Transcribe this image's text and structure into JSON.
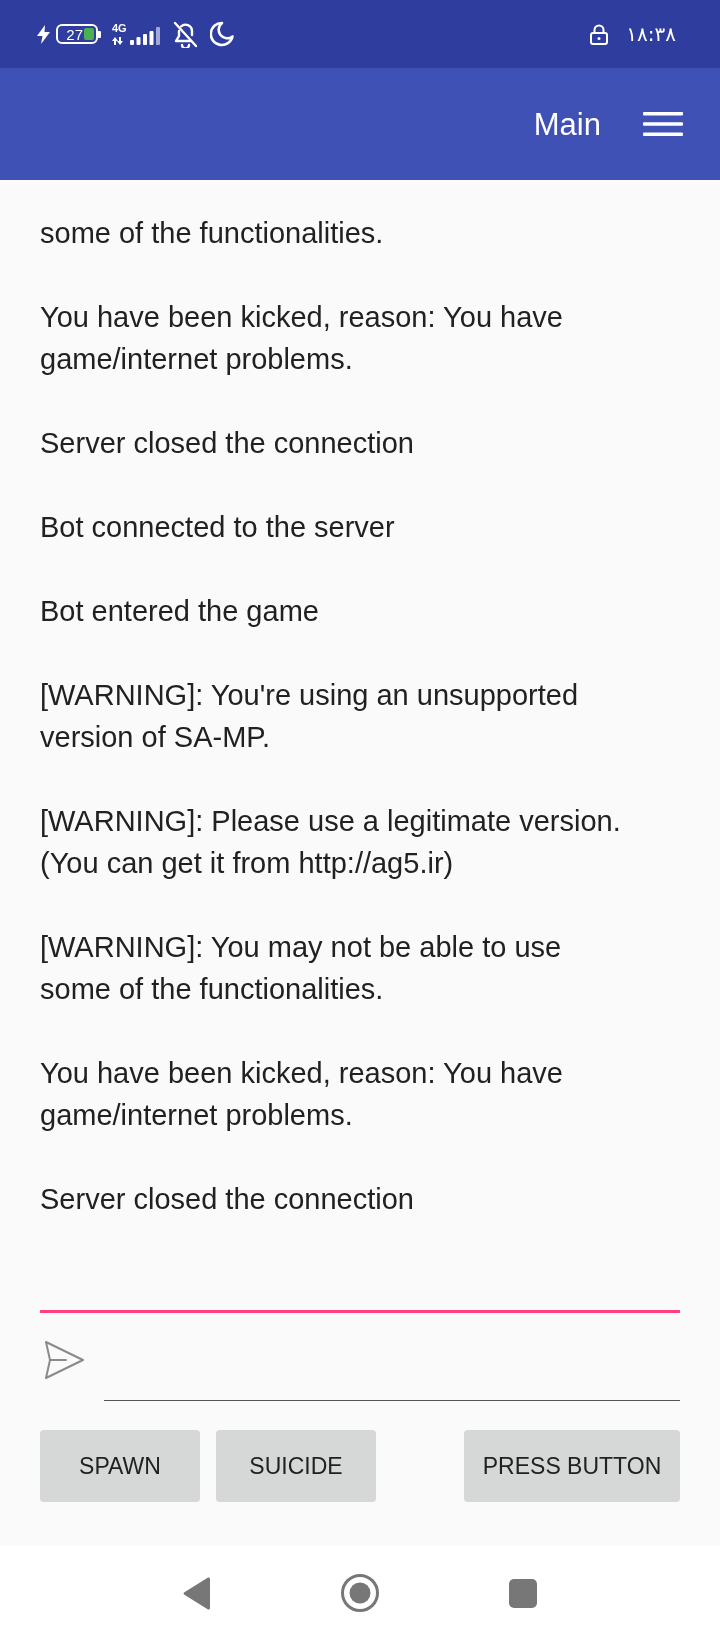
{
  "status_bar": {
    "battery": "27",
    "network": "4G",
    "time": "۱۸:۳۸"
  },
  "app_bar": {
    "title": "Main"
  },
  "log": {
    "partial_top": "some of the functionalities.",
    "messages": [
      "You have been kicked, reason: You have game/internet problems.",
      "Server closed the connection",
      "Bot connected to the server",
      "Bot entered the game",
      "[WARNING]: You're using an unsupported version of SA-MP.",
      "[WARNING]: Please use a legitimate version. (You can get it from http://ag5.ir)",
      "[WARNING]: You may not be able to use some of the functionalities.",
      "You have been kicked, reason: You have game/internet problems.",
      "Server closed the connection"
    ]
  },
  "left_buttons": [
    "SPAWN",
    "SUICIDE"
  ],
  "right_buttons": [
    "PRESS BUTTON"
  ]
}
